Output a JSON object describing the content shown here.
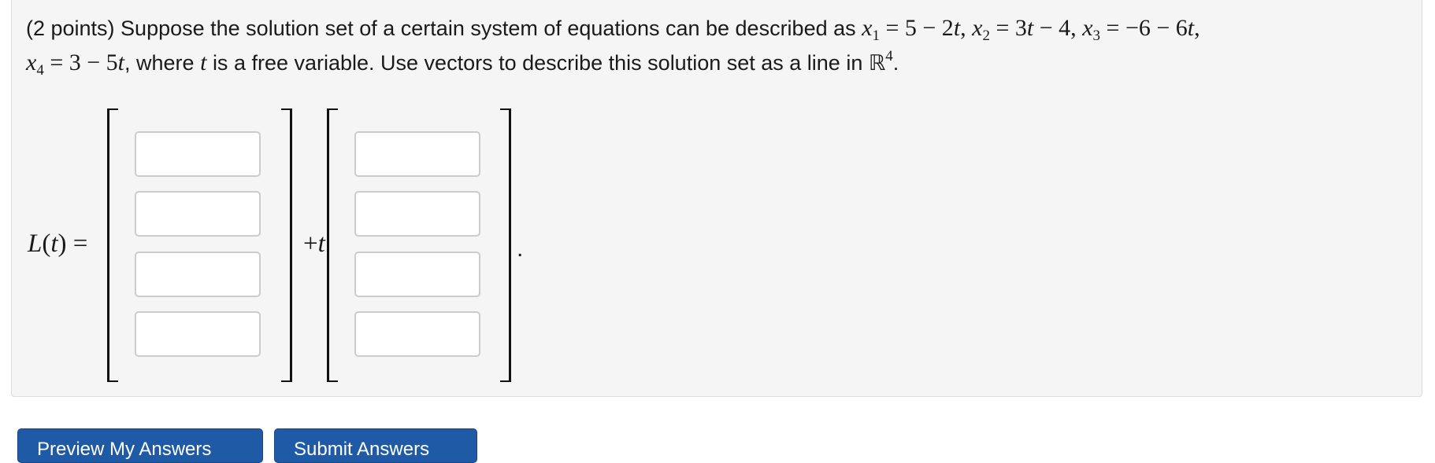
{
  "problem": {
    "intro": "(2 points) Suppose the solution set of a certain system of equations can be described as",
    "where_text": ", where",
    "free_var_text": "is a free variable. Use vectors to describe this solution set as a line in",
    "R4_symbol": "ℝ",
    "R4_exponent": "4"
  },
  "answer": {
    "lhs_label": "L(t) =",
    "plus_t_label": "+t",
    "end_period": ".",
    "point_vector": [
      "",
      "",
      "",
      ""
    ],
    "direction_vector": [
      "",
      "",
      "",
      ""
    ]
  },
  "buttons": {
    "preview_label": "Preview My Answers",
    "submit_label": "Submit Answers"
  },
  "colors": {
    "panel_bg": "#f5f5f5",
    "button_bg": "#1f5aa6"
  }
}
